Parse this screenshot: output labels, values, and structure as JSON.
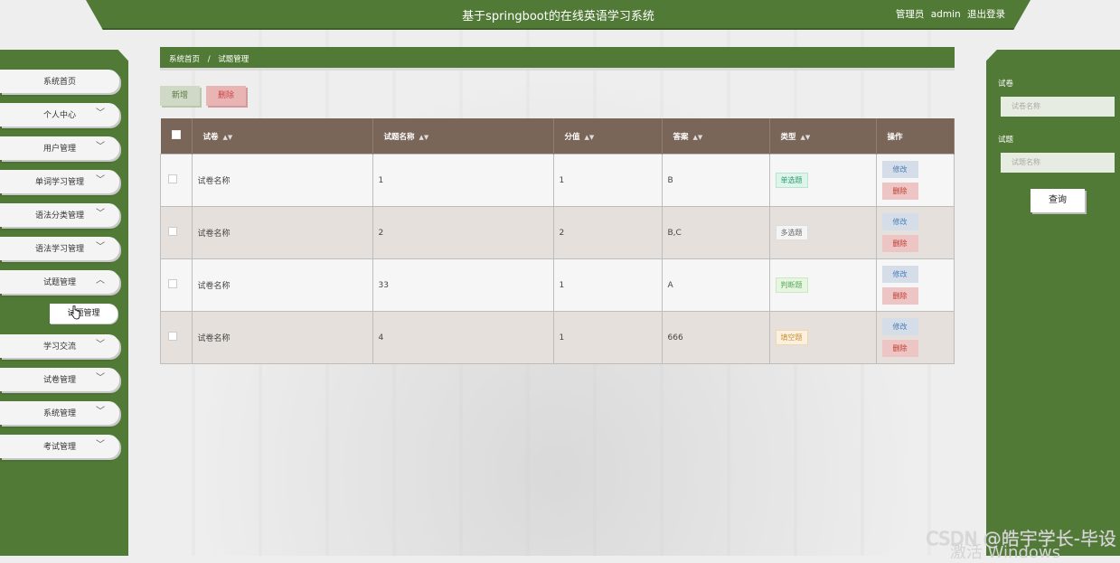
{
  "header": {
    "title": "基于springboot的在线英语学习系统",
    "user_role": "管理员",
    "username": "admin",
    "logout": "退出登录"
  },
  "sidebar": {
    "items": [
      {
        "label": "系统首页",
        "chevron": ""
      },
      {
        "label": "个人中心",
        "chevron": "﹀"
      },
      {
        "label": "用户管理",
        "chevron": "﹀"
      },
      {
        "label": "单词学习管理",
        "chevron": "﹀"
      },
      {
        "label": "语法分类管理",
        "chevron": "﹀"
      },
      {
        "label": "语法学习管理",
        "chevron": "﹀"
      },
      {
        "label": "试题管理",
        "chevron": "︿"
      }
    ],
    "sub_item": "试题管理",
    "items_after": [
      {
        "label": "学习交流",
        "chevron": "﹀"
      },
      {
        "label": "试卷管理",
        "chevron": "﹀"
      },
      {
        "label": "系统管理",
        "chevron": "﹀"
      },
      {
        "label": "考试管理",
        "chevron": "﹀"
      }
    ]
  },
  "breadcrumb": {
    "home": "系统首页",
    "separator": "/",
    "current": "试题管理"
  },
  "toolbar": {
    "add_label": "新增",
    "delete_label": "删除"
  },
  "table": {
    "columns": [
      "试卷",
      "试题名称",
      "分值",
      "答案",
      "类型",
      "操作"
    ],
    "sort_icon": "▲▼",
    "rows": [
      {
        "paper": "试卷名称",
        "name": "1",
        "score": "1",
        "answer": "B",
        "type": "单选题",
        "type_style": "single"
      },
      {
        "paper": "试卷名称",
        "name": "2",
        "score": "2",
        "answer": "B,C",
        "type": "多选题",
        "type_style": "multi"
      },
      {
        "paper": "试卷名称",
        "name": "33",
        "score": "1",
        "answer": "A",
        "type": "判断题",
        "type_style": "judge"
      },
      {
        "paper": "试卷名称",
        "name": "4",
        "score": "1",
        "answer": "666",
        "type": "填空题",
        "type_style": "fill"
      }
    ],
    "edit_label": "修改",
    "delete_label": "删除"
  },
  "search": {
    "paper_label": "试卷",
    "paper_placeholder": "试卷名称",
    "question_label": "试题",
    "question_placeholder": "试题名称",
    "button": "查询"
  },
  "watermark": {
    "csdn": "CSDN @皓宇学长-毕设",
    "windows": "激活 Windows"
  },
  "colors": {
    "brand_green": "#527a37",
    "table_header": "#7a6659"
  }
}
